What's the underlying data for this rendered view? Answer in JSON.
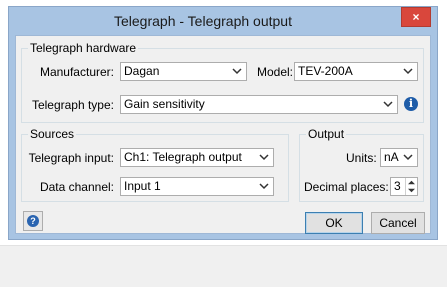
{
  "window": {
    "title": "Telegraph - Telegraph output",
    "close_glyph": "×"
  },
  "hardware": {
    "legend": "Telegraph hardware",
    "manufacturer_label": "Manufacturer:",
    "manufacturer_value": "Dagan",
    "model_label": "Model:",
    "model_value": "TEV-200A",
    "type_label": "Telegraph type:",
    "type_value": "Gain sensitivity",
    "info_glyph": "i"
  },
  "sources": {
    "legend": "Sources",
    "input_label": "Telegraph input:",
    "input_value": "Ch1: Telegraph output",
    "channel_label": "Data channel:",
    "channel_value": "Input 1"
  },
  "output": {
    "legend": "Output",
    "units_label": "Units:",
    "units_value": "nA",
    "decimals_label": "Decimal places:",
    "decimals_value": "3"
  },
  "buttons": {
    "ok": "OK",
    "cancel": "Cancel",
    "help_glyph": "?"
  },
  "colors": {
    "title_bar": "#a8c4e3",
    "close_button": "#d9473c",
    "dialog_bg": "#f0f0f0",
    "info_icon": "#1e5ca8"
  }
}
